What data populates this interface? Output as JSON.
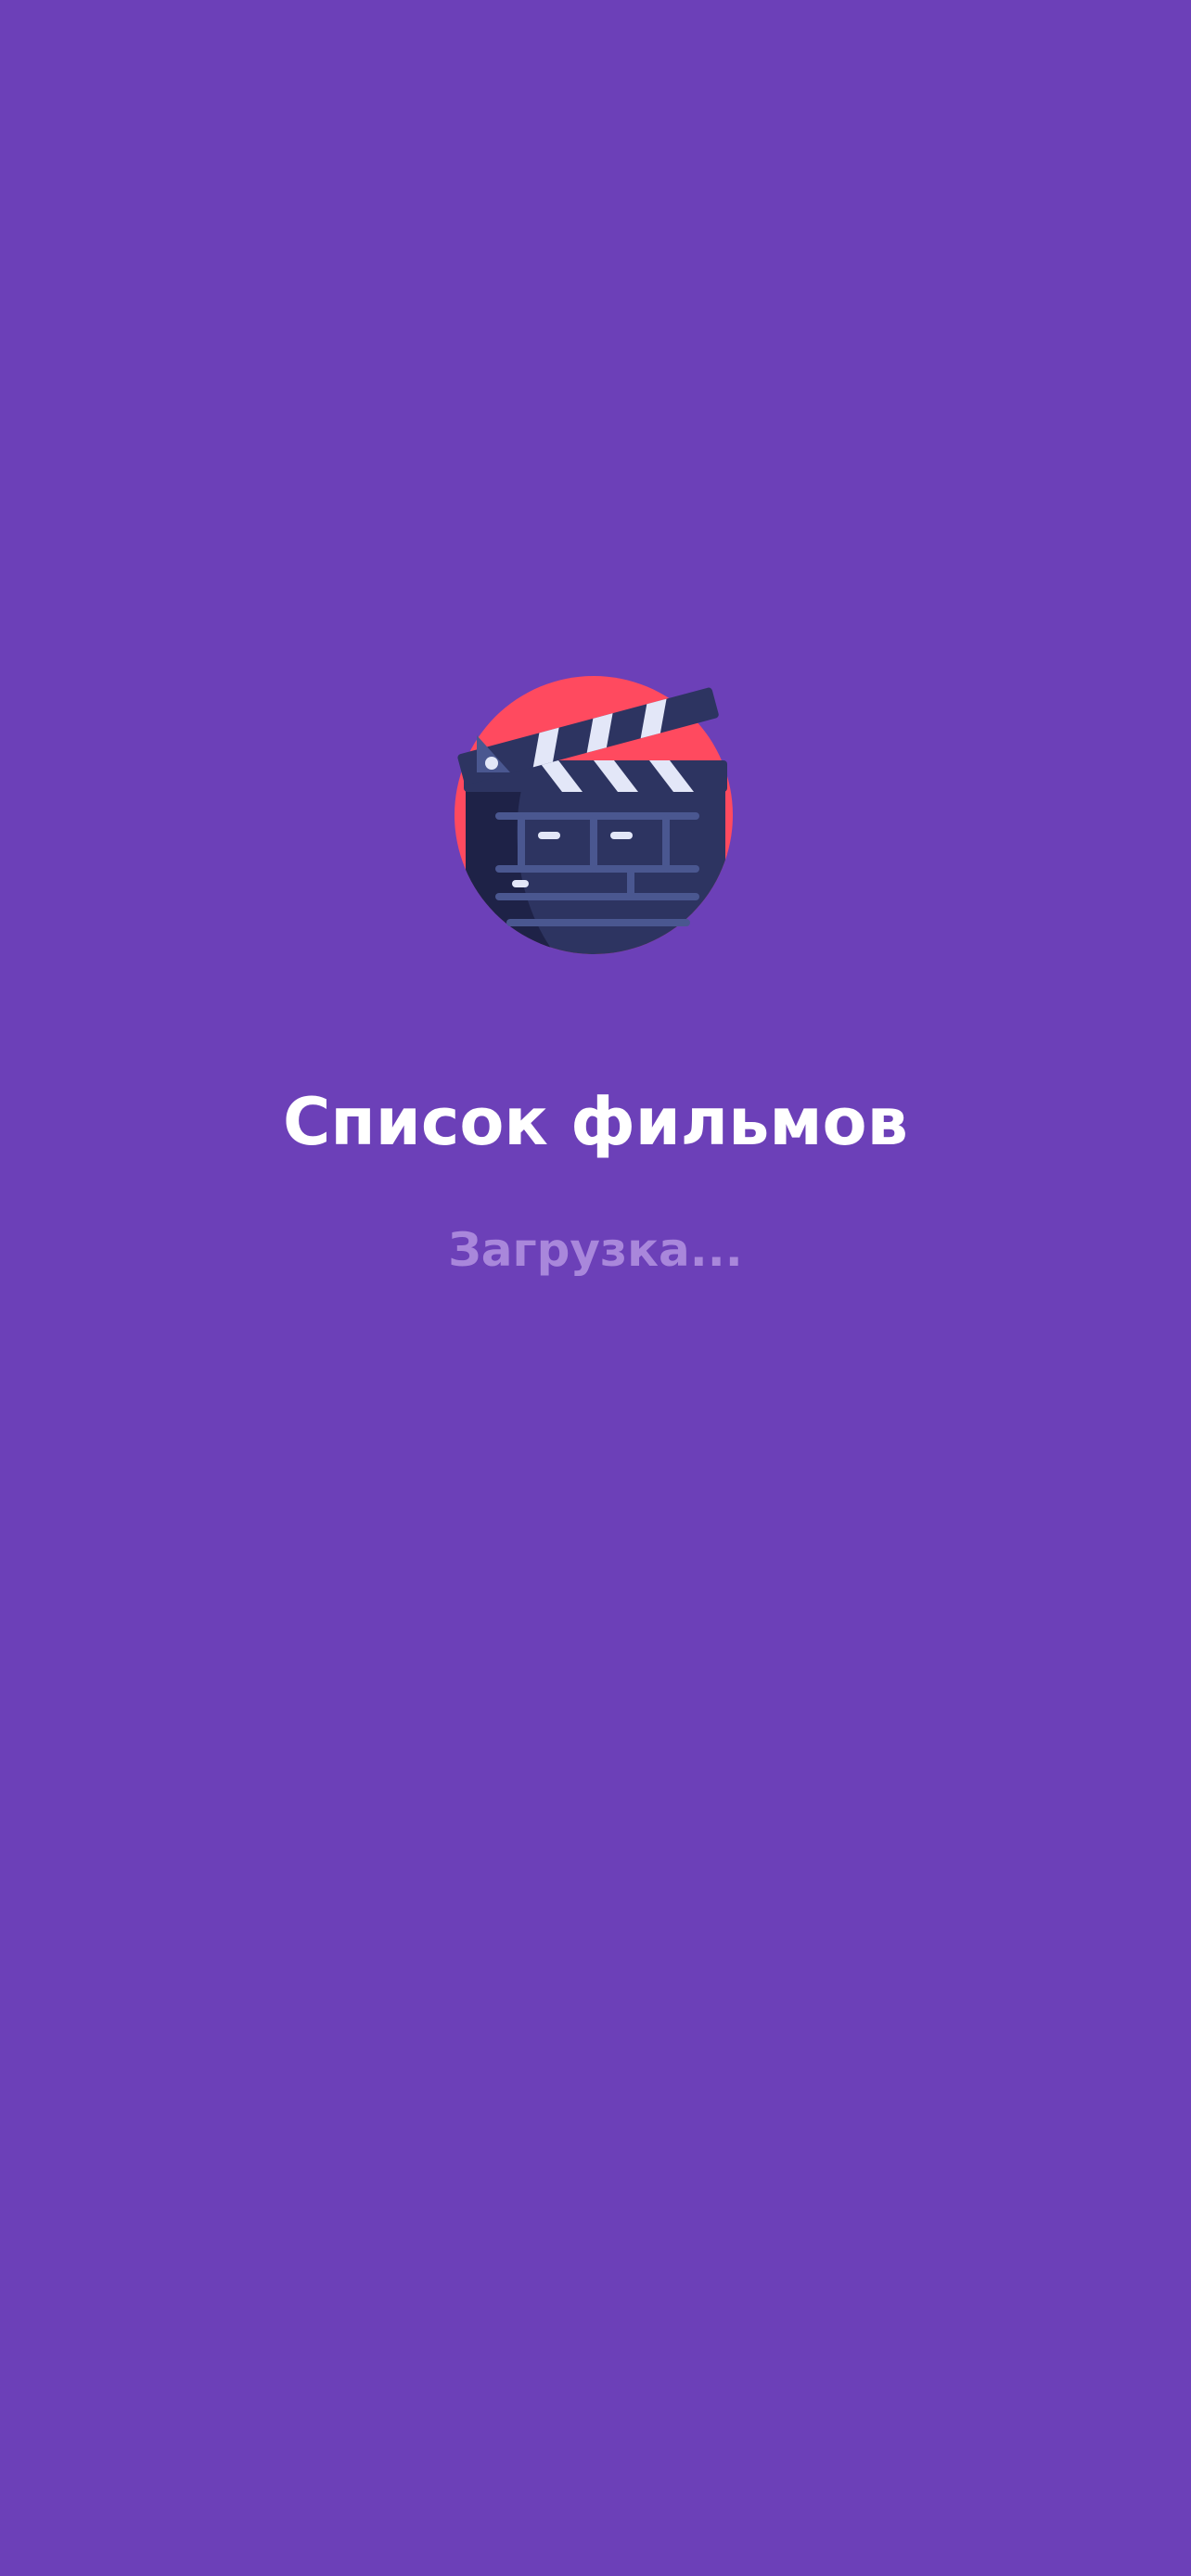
{
  "app": {
    "logo_icon": "clapperboard-icon",
    "title": "Список фильмов",
    "loading_text": "Загрузка..."
  },
  "colors": {
    "background": "#6C40B8",
    "title": "#FFFFFF",
    "loading": "#A987DB",
    "logo_circle": "#FF4A5F",
    "logo_board": "#2D3461",
    "logo_board_dark": "#1E2247",
    "logo_stripes": "#E3E7F8",
    "logo_lines": "#4A5790"
  }
}
